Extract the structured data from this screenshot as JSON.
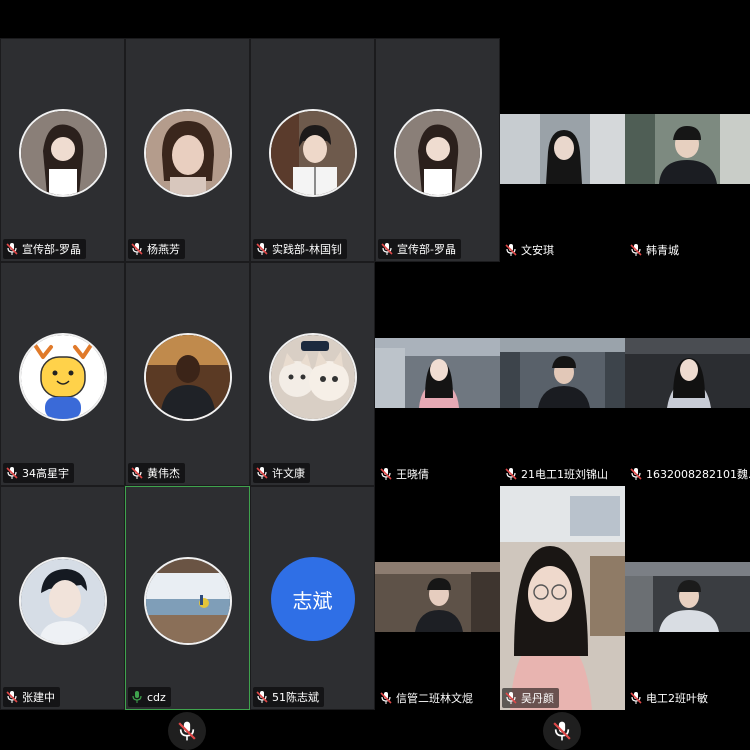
{
  "participants": [
    {
      "name": "宣传部-罗晶",
      "mic": "muted",
      "avatar": "girl-photo-avatar"
    },
    {
      "name": "杨燕芳",
      "mic": "muted",
      "avatar": "girl-photo-avatar"
    },
    {
      "name": "实践部-林国钊",
      "mic": "muted",
      "avatar": "boy-photo-avatar"
    },
    {
      "name": "宣传部-罗晶",
      "mic": "muted",
      "avatar": "girl-photo-avatar"
    },
    {
      "name": "文安琪",
      "mic": "muted",
      "avatar": "camera-video"
    },
    {
      "name": "韩青城",
      "mic": "muted",
      "avatar": "camera-video"
    },
    {
      "name": "34高星宇",
      "mic": "muted",
      "avatar": "cartoon-deer-avatar"
    },
    {
      "name": "黄伟杰",
      "mic": "muted",
      "avatar": "man-photo-avatar"
    },
    {
      "name": "许文康",
      "mic": "muted",
      "avatar": "cats-avatar"
    },
    {
      "name": "王晓倩",
      "mic": "muted",
      "avatar": "camera-video"
    },
    {
      "name": "21电工1班刘锦山",
      "mic": "muted",
      "avatar": "camera-video"
    },
    {
      "name": "1632008282101魏...",
      "mic": "muted",
      "avatar": "camera-video"
    },
    {
      "name": "张建中",
      "mic": "muted",
      "avatar": "boy-photo-avatar"
    },
    {
      "name": "cdz",
      "mic": "active",
      "avatar": "landscape-avatar"
    },
    {
      "name": "51陈志斌",
      "mic": "muted",
      "avatar_text": "志斌",
      "avatar": "text-avatar"
    },
    {
      "name": "信管二班林文焜",
      "mic": "muted",
      "avatar": "camera-video"
    },
    {
      "name": "吴丹颜",
      "mic": "muted",
      "avatar": "camera-video"
    },
    {
      "name": "电工2班叶敏",
      "mic": "muted",
      "avatar": "camera-video"
    }
  ],
  "colors": {
    "tile": "#2d2e31",
    "active_border": "#3fa34d",
    "text_avatar": "#2f6fe6",
    "muted_mic": "#e04848",
    "active_mic": "#3fa34d"
  },
  "bottom_controls": [
    {
      "icon": "mic-muted-icon"
    },
    {
      "icon": "mic-muted-icon"
    }
  ]
}
